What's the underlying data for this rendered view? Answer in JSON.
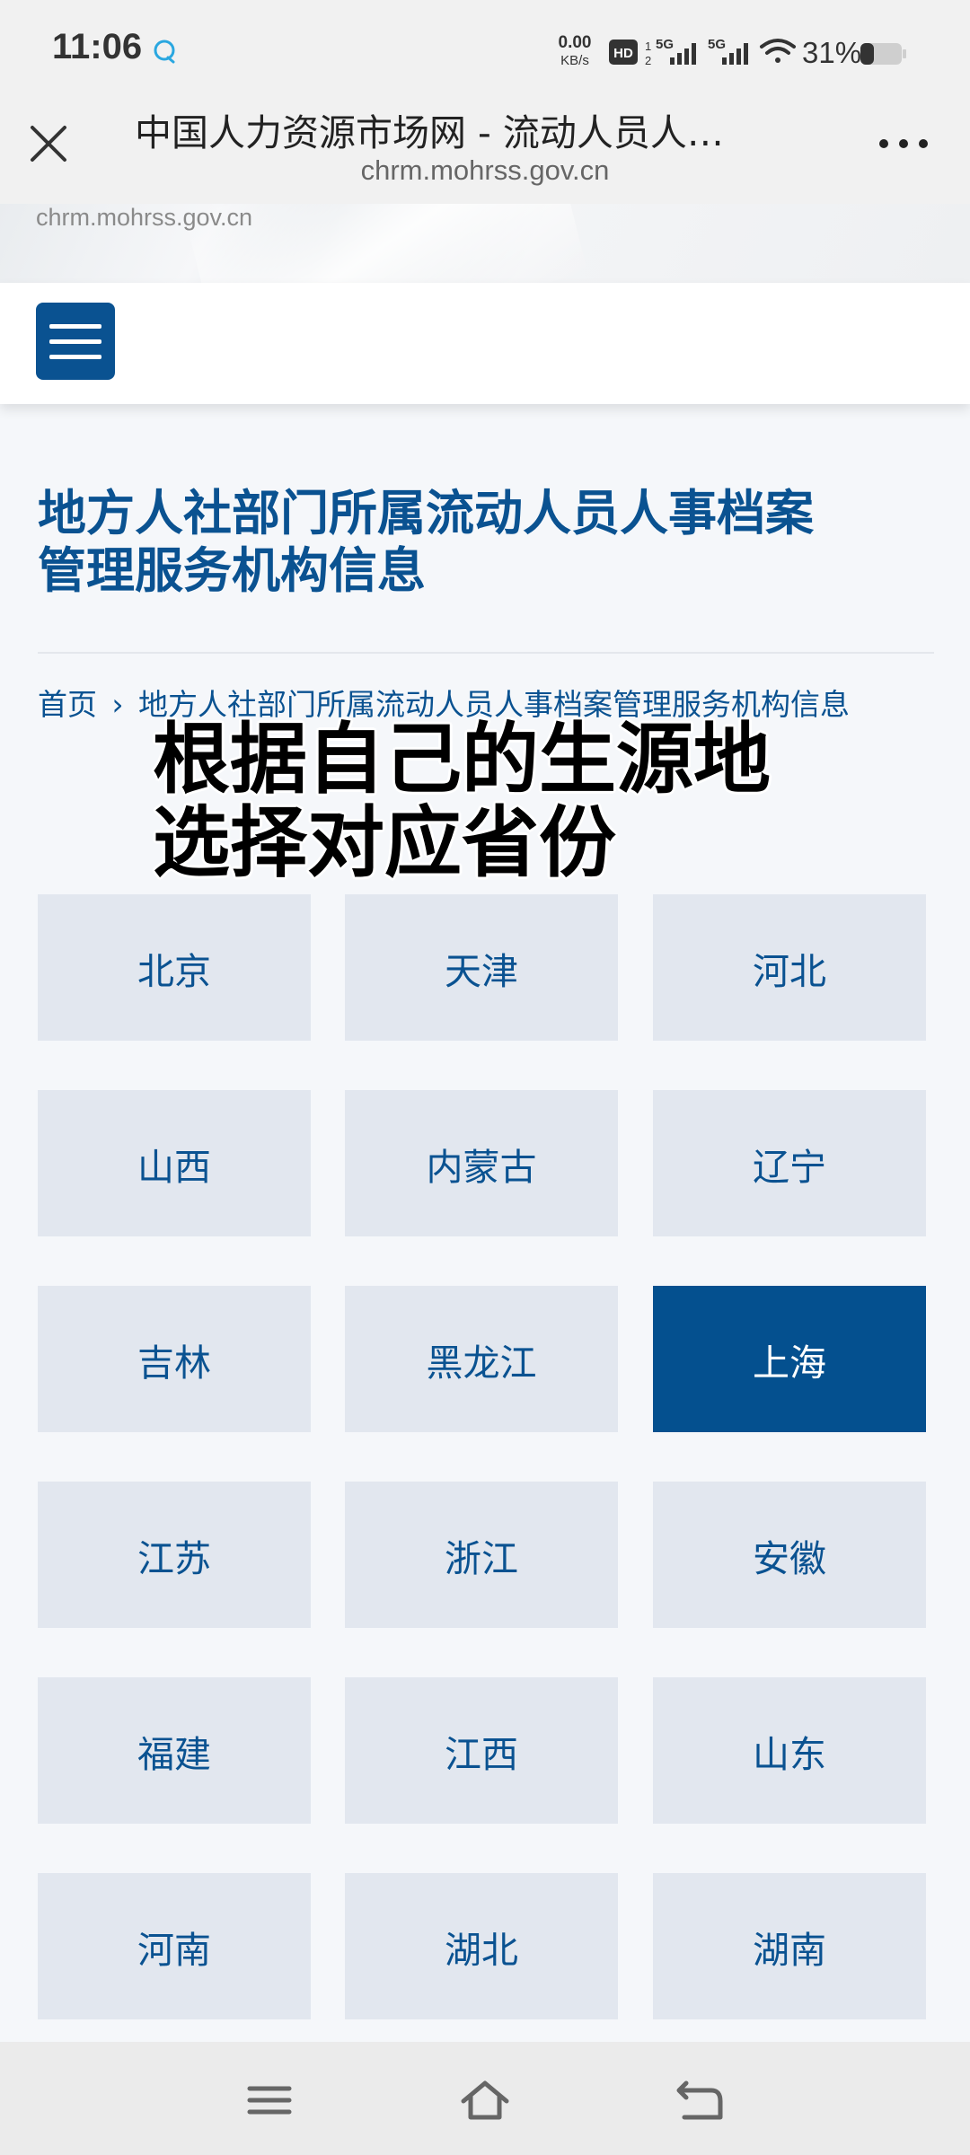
{
  "status_bar": {
    "time": "11:06",
    "net_speed_value": "0.00",
    "net_speed_unit": "KB/s",
    "battery_percent": "31%",
    "icons": [
      "app-notification-icon",
      "hd-icon",
      "signal-5g-icon",
      "signal-5g-icon",
      "wifi-icon",
      "battery-icon"
    ],
    "network_badges": [
      "HD",
      "5G",
      "5G"
    ]
  },
  "browser": {
    "title": "中国人力资源市场网 - 流动人员人…",
    "url": "chrm.mohrss.gov.cn"
  },
  "banner": {
    "url_text": "chrm.mohrss.gov.cn"
  },
  "page": {
    "heading_line1": "地方人社部门所属流动人员人事档案",
    "heading_line2": "管理服务机构信息",
    "breadcrumb": {
      "home": "首页",
      "separator": "›",
      "current": "地方人社部门所属流动人员人事档案管理服务机构信息"
    },
    "overlay_caption_line1": "根据自己的生源地",
    "overlay_caption_line2": "选择对应省份"
  },
  "provinces": [
    "北京",
    "天津",
    "河北",
    "山西",
    "内蒙古",
    "辽宁",
    "吉林",
    "黑龙江",
    "上海",
    "江苏",
    "浙江",
    "安徽",
    "福建",
    "江西",
    "山东",
    "河南",
    "湖北",
    "湖南"
  ],
  "selected_province": "上海",
  "colors": {
    "brand_blue": "#0a5291",
    "tile_bg": "#e2e7ef",
    "tile_active_bg": "#04508f"
  }
}
